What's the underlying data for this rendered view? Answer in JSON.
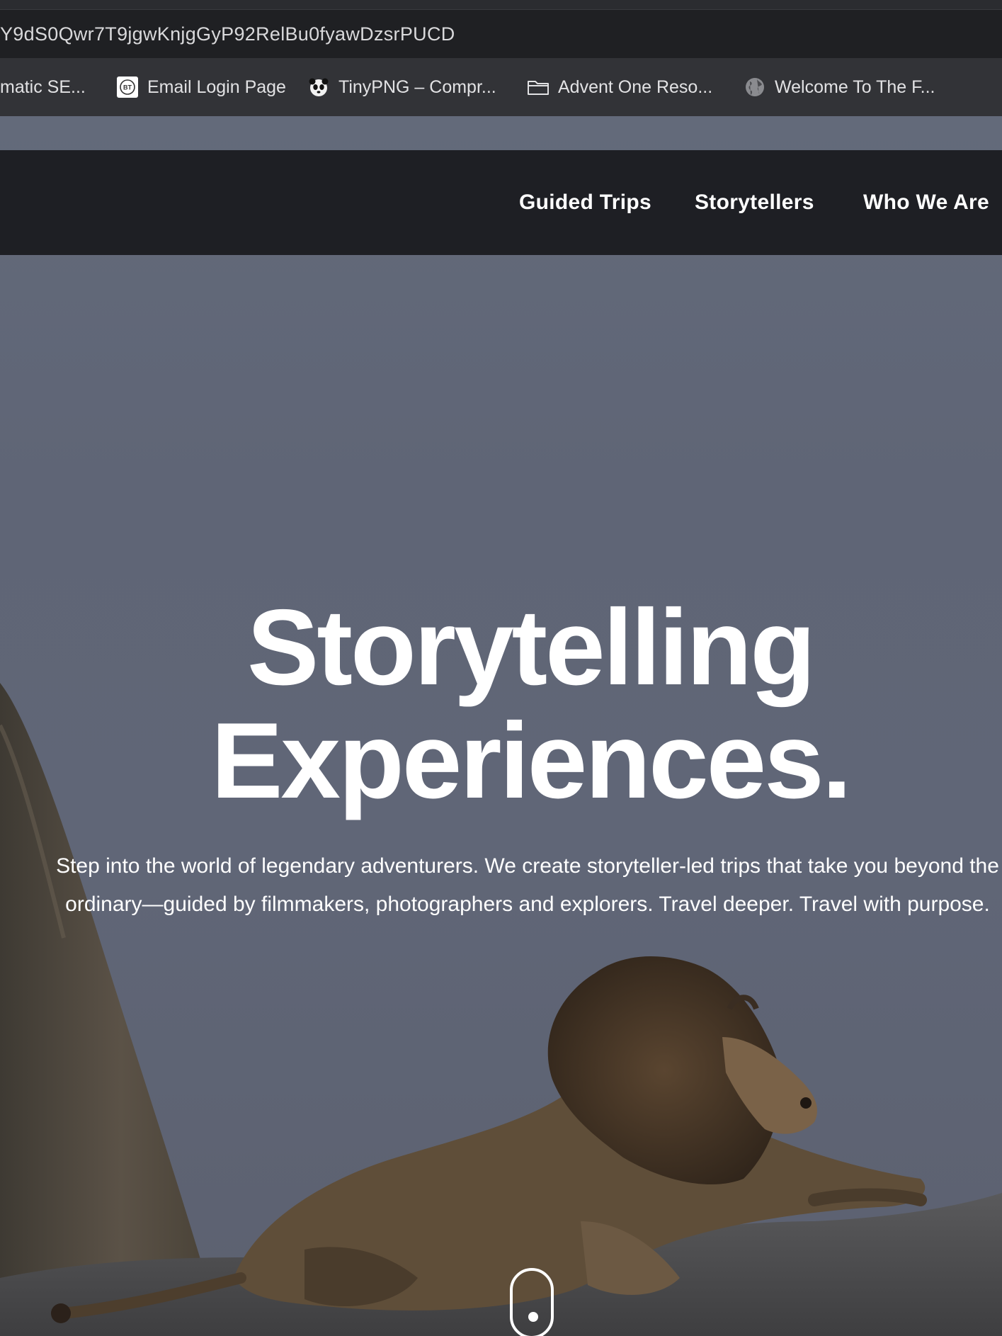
{
  "browser": {
    "url_text": "Y9dS0Qwr7T9jgwKnjgGyP92RelBu0fyawDzsrPUCD",
    "bookmarks": [
      {
        "label": "matic SE...",
        "icon": "page-icon"
      },
      {
        "label": "Email Login Page",
        "icon": "bt-logo-icon"
      },
      {
        "label": "TinyPNG – Compr...",
        "icon": "panda-icon"
      },
      {
        "label": "Advent One Reso...",
        "icon": "folder-icon"
      },
      {
        "label": "Welcome To The F...",
        "icon": "globe-icon"
      }
    ]
  },
  "nav": {
    "items": [
      {
        "label": "Guided Trips"
      },
      {
        "label": "Storytellers"
      },
      {
        "label": "Who We Are"
      }
    ]
  },
  "hero": {
    "title_line1": "Storytelling",
    "title_line2": "Experiences.",
    "subtitle_line1": "Step into the world of legendary adventurers. We create storyteller-led trips that take you beyond the",
    "subtitle_line2": "ordinary—guided by filmmakers, photographers and explorers. Travel deeper. Travel with purpose.",
    "background_image": "lion resting on rock against dusk sky",
    "scroll_indicator_icon": "mouse-scroll-icon"
  },
  "colors": {
    "nav_bg": "#1e1f24",
    "sky": "#606677",
    "text": "#ffffff"
  }
}
